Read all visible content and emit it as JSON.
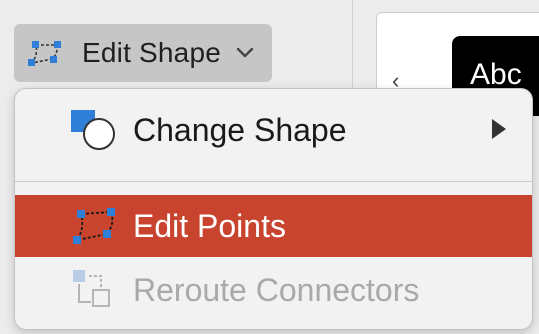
{
  "ribbon": {
    "edit_shape": {
      "label": "Edit Shape",
      "icon": "edit-shape-icon",
      "chevron_icon": "chevron-down-icon"
    },
    "style_gallery": {
      "thumb_label": "Abc",
      "prev_arrow": "‹"
    }
  },
  "menu": {
    "items": [
      {
        "label": "Change Shape",
        "icon": "change-shape-icon",
        "state": "normal",
        "has_submenu": true
      },
      {
        "label": "Edit Points",
        "icon": "edit-points-icon",
        "state": "highlighted",
        "has_submenu": false
      },
      {
        "label": "Reroute Connectors",
        "icon": "reroute-connectors-icon",
        "state": "disabled",
        "has_submenu": false
      }
    ]
  },
  "colors": {
    "highlight": "#c9442f",
    "icon_blue": "#2f7fd8",
    "disabled_text": "#a9a9a9"
  }
}
